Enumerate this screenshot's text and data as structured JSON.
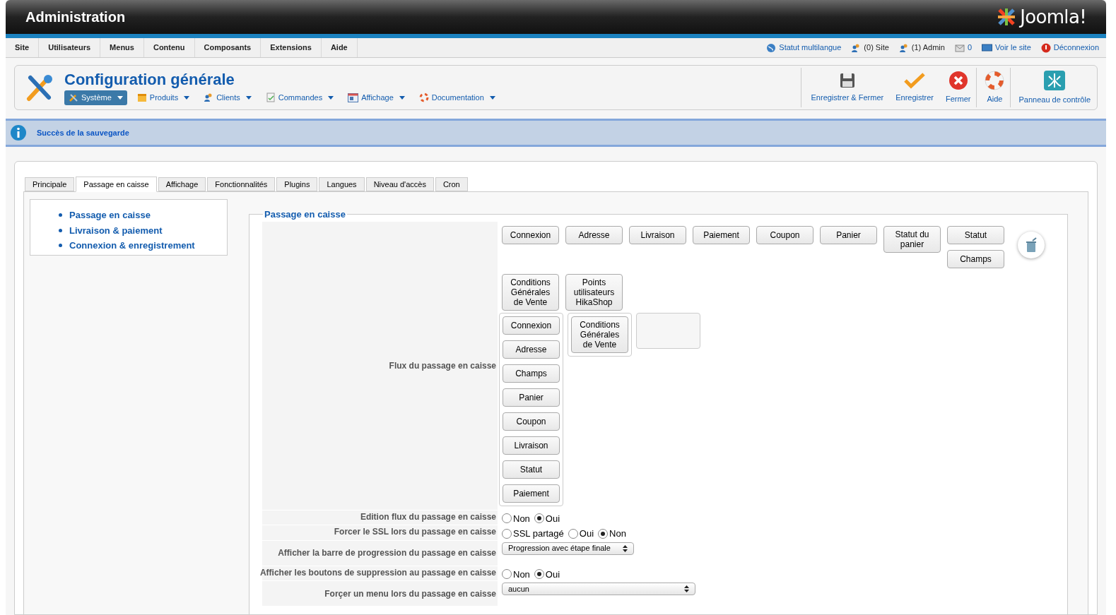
{
  "header": {
    "title": "Administration",
    "logo_text": "Joomla!"
  },
  "menu": [
    "Site",
    "Utilisateurs",
    "Menus",
    "Contenu",
    "Composants",
    "Extensions",
    "Aide"
  ],
  "status_links": [
    {
      "kind": "globe",
      "label": "Statut multilangue",
      "link": true
    },
    {
      "kind": "users",
      "label": "(0) Site",
      "link": false
    },
    {
      "kind": "users",
      "label": "(1) Admin",
      "link": false
    },
    {
      "kind": "mail",
      "label": "0",
      "link": true
    },
    {
      "kind": "screen",
      "label": "Voir le site",
      "link": true
    },
    {
      "kind": "logout",
      "label": "Déconnexion",
      "link": true
    }
  ],
  "toolbar": {
    "title": "Configuration générale",
    "submenu": [
      {
        "kind": "tools",
        "label": "Système",
        "selected": true
      },
      {
        "kind": "box",
        "label": "Produits",
        "selected": false
      },
      {
        "kind": "users",
        "label": "Clients",
        "selected": false
      },
      {
        "kind": "doc",
        "label": "Commandes",
        "selected": false
      },
      {
        "kind": "display",
        "label": "Affichage",
        "selected": false
      },
      {
        "kind": "help",
        "label": "Documentation",
        "selected": false
      }
    ],
    "actions": [
      {
        "kind": "save",
        "label": "Enregistrer & Fermer",
        "separator": false
      },
      {
        "kind": "check",
        "label": "Enregistrer",
        "separator": false
      },
      {
        "kind": "close",
        "label": "Fermer",
        "separator": true
      },
      {
        "kind": "help",
        "label": "Aide",
        "separator": true
      },
      {
        "kind": "panel",
        "label": "Panneau de contrôle",
        "separator": false
      }
    ]
  },
  "message": "Succès de la sauvegarde",
  "tabs": [
    {
      "label": "Principale",
      "selected": false
    },
    {
      "label": "Passage en caisse",
      "selected": true
    },
    {
      "label": "Affichage",
      "selected": false
    },
    {
      "label": "Fonctionnalités",
      "selected": false
    },
    {
      "label": "Plugins",
      "selected": false
    },
    {
      "label": "Langues",
      "selected": false
    },
    {
      "label": "Niveau d'accès",
      "selected": false
    },
    {
      "label": "Cron",
      "selected": false
    }
  ],
  "side_links": [
    "Passage en caisse",
    "Livraison & paiement",
    "Connexion & enregistrement"
  ],
  "fieldset": {
    "legend": "Passage en caisse",
    "flow": {
      "label": "Flux du passage en caisse",
      "palette": [
        [
          "Connexion"
        ],
        [
          "Adresse"
        ],
        [
          "Livraison"
        ],
        [
          "Paiement"
        ],
        [
          "Coupon"
        ],
        [
          "Panier"
        ],
        [
          "Statut du panier"
        ],
        [
          "Statut",
          "Champs"
        ],
        [
          "Conditions Générales de Vente"
        ],
        [
          "Points utilisateurs HikaShop"
        ]
      ],
      "columns": [
        {
          "kind": "steps",
          "steps": [
            "Connexion",
            "Adresse",
            "Champs",
            "Panier",
            "Coupon",
            "Livraison",
            "Statut",
            "Paiement"
          ]
        },
        {
          "kind": "steps",
          "steps": [
            "Conditions Générales de Vente"
          ]
        },
        {
          "kind": "placeholder"
        }
      ]
    },
    "options": [
      {
        "kind": "radio",
        "label": "Edition flux du passage en caisse",
        "options": [
          {
            "label": "Non",
            "selected": false
          },
          {
            "label": "Oui",
            "selected": true
          }
        ]
      },
      {
        "kind": "radio",
        "label": "Forcer le SSL lors du passage en caisse",
        "options": [
          {
            "label": "SSL partagé",
            "selected": false
          },
          {
            "label": "Oui",
            "selected": false
          },
          {
            "label": "Non",
            "selected": true
          }
        ]
      },
      {
        "kind": "select",
        "label": "Afficher la barre de progression du passage en caisse",
        "value": "Progression avec étape finale",
        "wide": false
      },
      {
        "kind": "radio",
        "label": "Afficher les boutons de suppression au passage en caisse",
        "options": [
          {
            "label": "Non",
            "selected": false
          },
          {
            "label": "Oui",
            "selected": true
          }
        ]
      },
      {
        "kind": "select",
        "label": "Forçer un menu lors du passage en caisse",
        "value": "aucun",
        "wide": true
      }
    ]
  }
}
